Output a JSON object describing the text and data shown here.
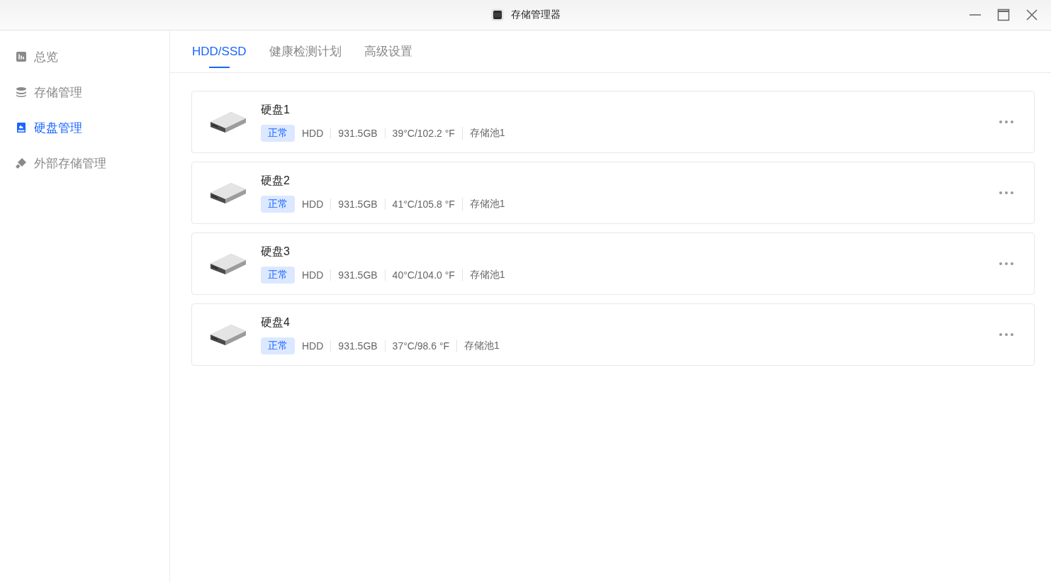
{
  "window": {
    "title": "存储管理器"
  },
  "sidebar": {
    "items": [
      {
        "label": "总览",
        "kind": "overview",
        "selected": false
      },
      {
        "label": "存储管理",
        "kind": "storage",
        "selected": false
      },
      {
        "label": "硬盘管理",
        "kind": "disk",
        "selected": true
      },
      {
        "label": "外部存储管理",
        "kind": "external",
        "selected": false
      }
    ]
  },
  "tabs": [
    {
      "label": "HDD/SSD",
      "selected": true
    },
    {
      "label": "健康检测计划",
      "selected": false
    },
    {
      "label": "高级设置",
      "selected": false
    }
  ],
  "disks": [
    {
      "name": "硬盘1",
      "status": "正常",
      "type": "HDD",
      "capacity": "931.5GB",
      "temperature": "39°C/102.2 °F",
      "pool": "存储池1"
    },
    {
      "name": "硬盘2",
      "status": "正常",
      "type": "HDD",
      "capacity": "931.5GB",
      "temperature": "41°C/105.8 °F",
      "pool": "存储池1"
    },
    {
      "name": "硬盘3",
      "status": "正常",
      "type": "HDD",
      "capacity": "931.5GB",
      "temperature": "40°C/104.0 °F",
      "pool": "存储池1"
    },
    {
      "name": "硬盘4",
      "status": "正常",
      "type": "HDD",
      "capacity": "931.5GB",
      "temperature": "37°C/98.6 °F",
      "pool": "存储池1"
    }
  ]
}
